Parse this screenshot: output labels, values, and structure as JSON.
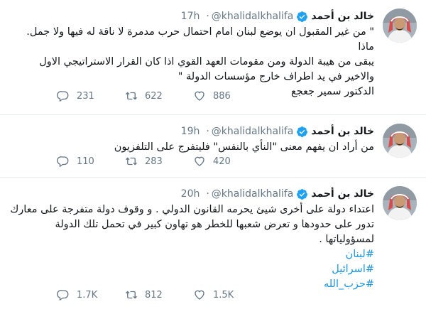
{
  "colors": {
    "accent": "#1da1f2",
    "hashtag": "#1b95e0",
    "meta": "#657786",
    "text": "#14171a",
    "divider": "#e6ecf0"
  },
  "tweets": [
    {
      "author": {
        "name": "خالد بن أحمد",
        "handle": "@khalidalkhalifa",
        "verified": true
      },
      "time": "17h",
      "lines": [
        "\" من غير المقبول ان يوضع لبنان امام احتمال حرب مدمرة لا ناقة له فيها ولا جمل. ماذا",
        "يبقى من هيبة الدولة ومن مقومات العهد القوي اذا كان القرار الاستراتيجي الاول",
        "والاخير في يد اطراف خارج مؤسسات الدولة \"",
        "الدكتور سمير جعجع"
      ],
      "hashtags": [],
      "counts": {
        "replies": "231",
        "retweets": "622",
        "likes": "886"
      }
    },
    {
      "author": {
        "name": "خالد بن أحمد",
        "handle": "@khalidalkhalifa",
        "verified": true
      },
      "time": "19h",
      "lines": [
        "من أراد ان يفهم معنى \"النأي بالنفس\" فليتفرج على التلفزيون"
      ],
      "hashtags": [],
      "counts": {
        "replies": "110",
        "retweets": "283",
        "likes": "420"
      }
    },
    {
      "author": {
        "name": "خالد بن أحمد",
        "handle": "@khalidalkhalifa",
        "verified": true
      },
      "time": "20h",
      "lines": [
        "اعتداء دولة على أخرى شيئ يحرمه القانون الدولي . و وقوف دولة متفرجة على معارك",
        "تدور على حدودها و تعرض شعبها للخطر هو تهاون كبير في تحمل تلك الدولة",
        "لمسؤولياتها ."
      ],
      "hashtags": [
        "#لبنان",
        "#اسرائيل",
        "#حزب_الله"
      ],
      "counts": {
        "replies": "1.7K",
        "retweets": "812",
        "likes": "1.5K"
      }
    }
  ],
  "icons": {
    "reply": "reply-icon",
    "retweet": "retweet-icon",
    "like": "heart-icon",
    "verified": "verified-badge-icon"
  }
}
